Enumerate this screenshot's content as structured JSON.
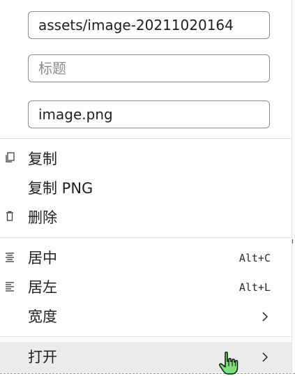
{
  "fields": {
    "path_value": "assets/image-20211020164",
    "title_placeholder": "标题",
    "alt_value": "image.png"
  },
  "menu": {
    "copy": "复制",
    "copy_png": "复制 PNG",
    "delete": "删除",
    "center": "居中",
    "center_shortcut": "Alt+C",
    "left": "居左",
    "left_shortcut": "Alt+L",
    "width": "宽度",
    "open": "打开"
  },
  "icons": {
    "copy": "copy-icon",
    "delete": "trash-icon",
    "center": "align-center-icon",
    "left": "align-left-icon",
    "submenu": "chevron-right-icon",
    "cursor": "hand-pointer-icon"
  },
  "colors": {
    "hover_bg": "#ebebeb",
    "cursor_fill": "#7be07b"
  }
}
